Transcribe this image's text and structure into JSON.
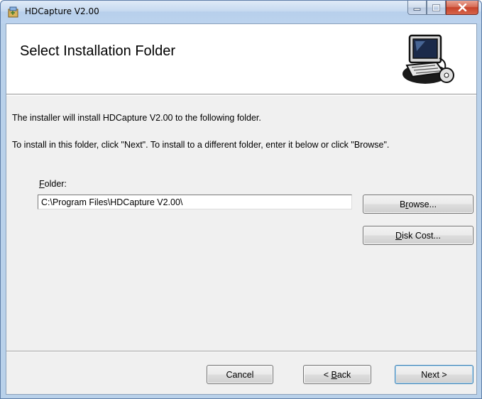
{
  "window": {
    "title": "HDCapture V2.00",
    "controls": {
      "minimize": "minimize-icon",
      "maximize": "maximize-icon",
      "close": "close-icon"
    }
  },
  "header": {
    "title": "Select Installation Folder",
    "art_icon": "computer-setup-icon"
  },
  "body": {
    "line1": "The installer will install HDCapture V2.00 to the following folder.",
    "line2": "To install in this folder, click \"Next\". To install to a different folder, enter it below or click \"Browse\".",
    "folder_label_accel": "F",
    "folder_label_rest": "older:",
    "folder_value": "C:\\Program Files\\HDCapture V2.00\\"
  },
  "buttons": {
    "browse_pre": "B",
    "browse_accel": "r",
    "browse_post": "owse...",
    "diskcost_accel": "D",
    "diskcost_post": "isk Cost...",
    "cancel": "Cancel",
    "back_pre": "< ",
    "back_accel": "B",
    "back_post": "ack",
    "next": "Next >"
  },
  "colors": {
    "titlebar": "#c7daf0",
    "client": "#f0f0f0",
    "close_button": "#c7432b",
    "default_button_border": "#3c7fb1"
  }
}
